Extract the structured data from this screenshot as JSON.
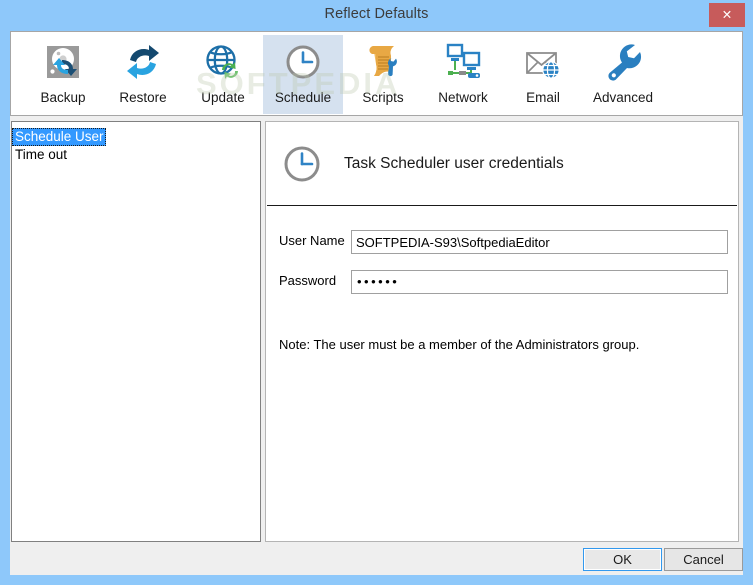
{
  "window": {
    "title": "Reflect Defaults",
    "close_label": "✕",
    "frame_color": "#8ec8fa",
    "watermark": "SOFTPEDIA"
  },
  "toolbar": {
    "items": [
      {
        "label": "Backup",
        "icon": "hard-disk-backup-icon",
        "selected": false
      },
      {
        "label": "Restore",
        "icon": "restore-arrows-icon",
        "selected": false
      },
      {
        "label": "Update",
        "icon": "globe-refresh-icon",
        "selected": false
      },
      {
        "label": "Schedule",
        "icon": "clock-icon",
        "selected": true
      },
      {
        "label": "Scripts",
        "icon": "scroll-wrench-icon",
        "selected": false
      },
      {
        "label": "Network",
        "icon": "network-computers-icon",
        "selected": false
      },
      {
        "label": "Email",
        "icon": "envelope-globe-icon",
        "selected": false
      },
      {
        "label": "Advanced",
        "icon": "wrench-icon",
        "selected": false
      }
    ]
  },
  "sidebar": {
    "items": [
      {
        "label": "Schedule User",
        "selected": true
      },
      {
        "label": "Time out",
        "selected": false
      }
    ]
  },
  "content": {
    "header_title": "Task Scheduler user credentials",
    "header_icon": "clock-icon",
    "fields": [
      {
        "label": "User Name",
        "value": "SOFTPEDIA-S93\\SoftpediaEditor",
        "placeholder": ""
      },
      {
        "label": "Password",
        "value": "••••••",
        "placeholder": ""
      }
    ],
    "note": "Note: The user must be a member of the Administrators group."
  },
  "footer": {
    "ok_label": "OK",
    "cancel_label": "Cancel"
  },
  "colors": {
    "accent": "#3399ff",
    "titlebar": "#8ec8fa",
    "close_red": "#c75b5b",
    "selected_tool": "#d5e1ef"
  }
}
